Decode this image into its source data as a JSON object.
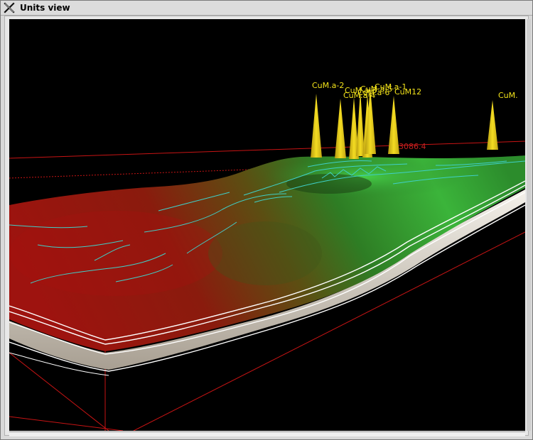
{
  "window": {
    "title": "Units view",
    "close_icon": "x-close-icon"
  },
  "scene": {
    "background": "#000000",
    "bounding_box_color": "#c81414",
    "surface_colors": [
      "#9c120e",
      "#6e4a10",
      "#2f8a2a",
      "#3ec43a"
    ],
    "contour_color": "#3fd0c8",
    "layer_line_color": "#ffffff",
    "well_color": "#f2d21c",
    "value_label": "3086.4",
    "wells": [
      {
        "label": "CuM.a-2"
      },
      {
        "label": "CuM.a-3"
      },
      {
        "label": "CuM.a-4"
      },
      {
        "label": "CuM.a-5"
      },
      {
        "label": "CuM.a-6"
      },
      {
        "label": "CuM.a-1"
      },
      {
        "label": "CuM12"
      },
      {
        "label": "CuM."
      }
    ]
  }
}
